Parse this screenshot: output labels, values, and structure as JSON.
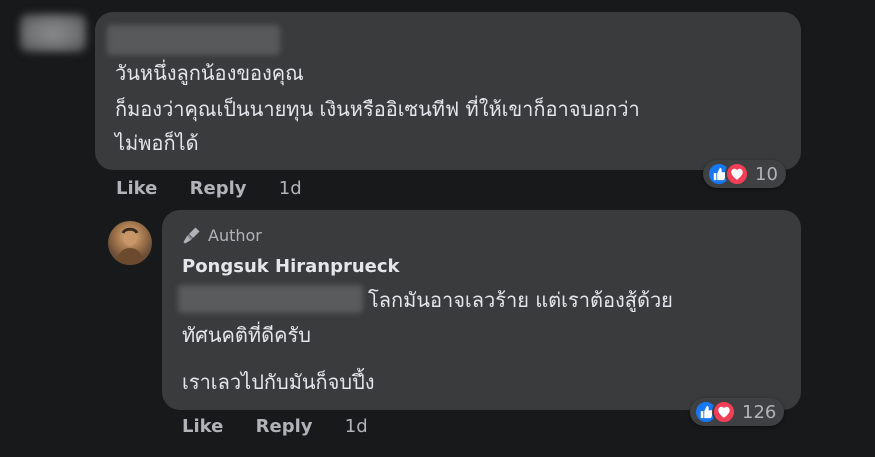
{
  "comment1": {
    "lines": [
      "วันหนึ่งลูกน้องของคุณ",
      "ก็มองว่าคุณเป็นนายทุน เงินหรืออิเซนทีฟ ที่ให้เขาก็อาจบอกว่า",
      "ไม่พอก็ได้"
    ],
    "reactions": {
      "icons": [
        "like-icon",
        "love-icon"
      ],
      "count": "10"
    },
    "actions": {
      "like": "Like",
      "reply": "Reply",
      "time": "1d"
    }
  },
  "reply1": {
    "badge": "Author",
    "author": "Pongsuk Hiranprueck",
    "lines": [
      "โลกมันอาจเลวร้าย แต่เราต้องสู้ด้วย",
      "ทัศนคติที่ดีครับ",
      "เราเลวไปกับมันก็จบปึ้ง"
    ],
    "reactions": {
      "icons": [
        "like-icon",
        "love-icon"
      ],
      "count": "126"
    },
    "actions": {
      "like": "Like",
      "reply": "Reply",
      "time": "1d"
    }
  },
  "colors": {
    "background": "#18191a",
    "bubble": "#3a3b3c",
    "text": "#e4e6eb",
    "secondary_text": "#b0b3b8",
    "like_blue": "#1877f2",
    "love_red": "#f33e58"
  }
}
